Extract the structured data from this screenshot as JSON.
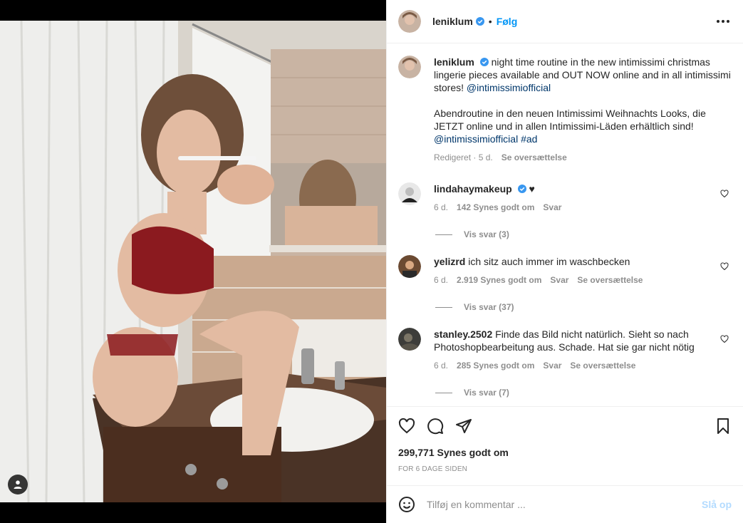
{
  "post": {
    "username": "leniklum",
    "follow_label": "Følg",
    "dot": "•",
    "more_icon": "more-horizontal-icon"
  },
  "caption": {
    "username": "leniklum",
    "text_1": "night time routine in the new intimissimi christmas lingerie pieces available and OUT NOW online and in all intimissimi stores! ",
    "mention_1": "@intimissimiofficial",
    "text_2": "Abendroutine in den neuen Intimissimi Weihnachts Looks, die JETZT online und in allen Intimissimi-Läden erhältlich sind!",
    "mention_2": "@intimissimiofficial",
    "hashtag": "#ad",
    "edited": "Redigeret · 5 d.",
    "translate": "Se oversættelse"
  },
  "comments": [
    {
      "username": "lindahaymakeup",
      "text": "♥",
      "age": "6 d.",
      "likes": "142 Synes godt om",
      "reply": "Svar",
      "translate": "",
      "view_replies": "Vis svar (3)"
    },
    {
      "username": "yelizrd",
      "text": "ich sitz auch immer im waschbecken",
      "age": "6 d.",
      "likes": "2.919 Synes godt om",
      "reply": "Svar",
      "translate": "Se oversættelse",
      "view_replies": "Vis svar (37)"
    },
    {
      "username": "stanley.2502",
      "text": "Finde das Bild nicht natürlich. Sieht so nach Photoshopbearbeitung aus. Schade. Hat sie gar nicht nötig",
      "age": "6 d.",
      "likes": "285 Synes godt om",
      "reply": "Svar",
      "translate": "Se oversættelse",
      "view_replies": "Vis svar (7)"
    }
  ],
  "actions": {
    "like_icon": "heart-icon",
    "comment_icon": "comment-icon",
    "share_icon": "send-icon",
    "save_icon": "bookmark-icon",
    "likes": "299,771 Synes godt om",
    "time": "FOR 6 DAGE SIDEN"
  },
  "composer": {
    "placeholder": "Tilføj en kommentar ...",
    "post_label": "Slå op",
    "emoji_icon": "emoji-icon"
  },
  "colors": {
    "accent": "#0095f6",
    "verified": "#3897f0",
    "mention": "#00376b",
    "muted": "#8e8e8e"
  }
}
